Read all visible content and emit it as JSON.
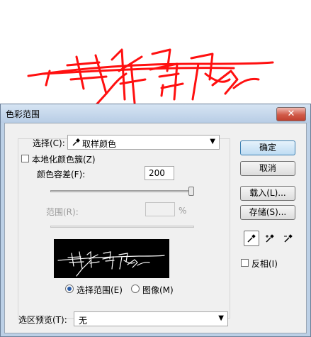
{
  "dialog": {
    "title": "色彩范围",
    "close_label": "✕",
    "select": {
      "label": "选择(C):",
      "value": "取样颜色"
    },
    "localized_clusters": {
      "label": "本地化颜色簇(Z)",
      "checked": false
    },
    "fuzziness": {
      "label": "颜色容差(F):",
      "value": "200",
      "slider_fraction": 1.0
    },
    "range": {
      "label": "范围(R):",
      "value": "",
      "unit": "%"
    },
    "view": {
      "selection_label": "选择范围(E)",
      "image_label": "图像(M)",
      "selected": "selection"
    },
    "selection_preview": {
      "label": "选区预览(T):",
      "value": "无"
    },
    "buttons": {
      "ok": "确定",
      "cancel": "取消",
      "load": "载入(L)...",
      "save": "存储(S)..."
    },
    "invert": {
      "label": "反相(I)",
      "checked": false
    },
    "tools": [
      "eyedropper-icon",
      "eyedropper-plus-icon",
      "eyedropper-minus-icon"
    ]
  },
  "colors": {
    "signature": "#ff0000",
    "title_bar": "#bcd0e6",
    "face": "#f0f0f0"
  }
}
